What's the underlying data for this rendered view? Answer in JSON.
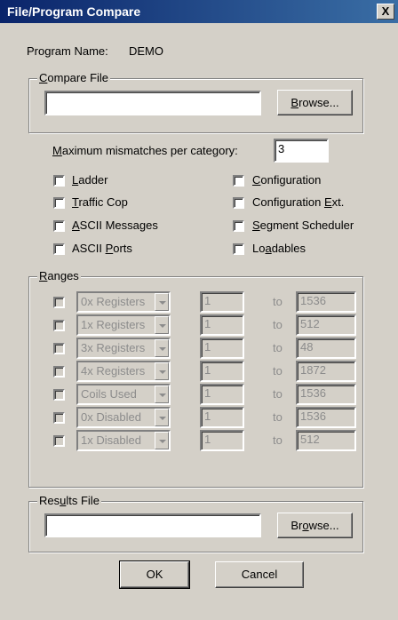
{
  "window": {
    "title": "File/Program Compare",
    "close_glyph": "X"
  },
  "program": {
    "label": "Program Name:",
    "value": "DEMO"
  },
  "compare_file": {
    "legend": "Compare File",
    "value": "",
    "browse_label": "Browse..."
  },
  "max_mismatch": {
    "label": "Maximum mismatches per category:",
    "value": "3"
  },
  "options_left": [
    {
      "label": "Ladder"
    },
    {
      "label": "Traffic Cop"
    },
    {
      "label": "ASCII Messages"
    },
    {
      "label": "ASCII Ports"
    }
  ],
  "options_right": [
    {
      "label": "Configuration"
    },
    {
      "label": "Configuration Ext."
    },
    {
      "label": "Segment Scheduler"
    },
    {
      "label": "Loadables"
    }
  ],
  "ranges": {
    "legend": "Ranges",
    "to_label": "to",
    "rows": [
      {
        "type": "0x Registers",
        "from": "1",
        "to": "1536"
      },
      {
        "type": "1x Registers",
        "from": "1",
        "to": "512"
      },
      {
        "type": "3x Registers",
        "from": "1",
        "to": "48"
      },
      {
        "type": "4x Registers",
        "from": "1",
        "to": "1872"
      },
      {
        "type": "Coils Used",
        "from": "1",
        "to": "1536"
      },
      {
        "type": "0x Disabled",
        "from": "1",
        "to": "1536"
      },
      {
        "type": "1x Disabled",
        "from": "1",
        "to": "512"
      }
    ]
  },
  "results_file": {
    "legend": "Results File",
    "value": "",
    "browse_label": "Browse..."
  },
  "buttons": {
    "ok": "OK",
    "cancel": "Cancel"
  }
}
